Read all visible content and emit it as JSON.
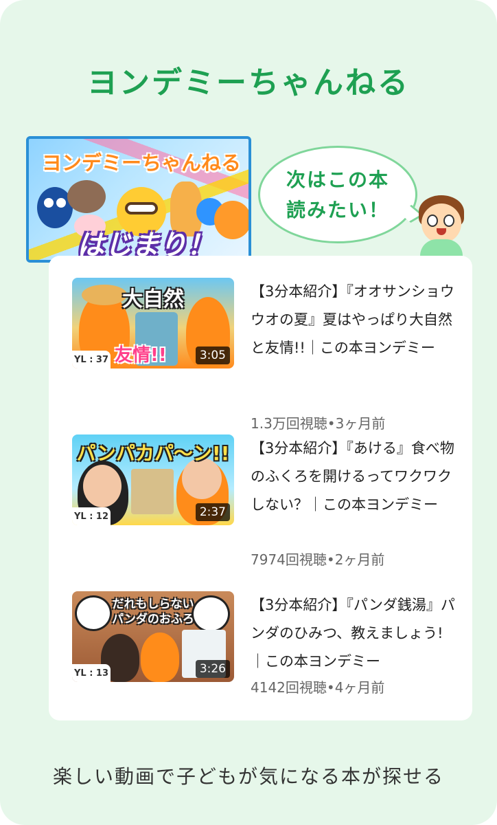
{
  "page": {
    "title": "ヨンデミーちゃんねる",
    "footer_text": "楽しい動画で子どもが気になる本が探せる"
  },
  "banner": {
    "title": "ヨンデミーちゃんねる",
    "subtitle": "はじまり！"
  },
  "bubble": {
    "line1": "次はこの本",
    "line2": "読みたい！"
  },
  "videos": [
    {
      "thumb_title": "大自然",
      "thumb_sub": "友情!!",
      "yl": "YL : 37",
      "duration": "3:05",
      "title": "【3分本紹介】『オオサンショウウオの夏』夏はやっぱり大自然と友情!!｜この本ヨンデミー",
      "meta": "1.3万回視聴•3ヶ月前"
    },
    {
      "thumb_title": "パンパカパ〜ン!!",
      "thumb_sub": "",
      "yl": "YL : 12",
      "duration": "2:37",
      "title": "【3分本紹介】『あける』食べ物のふくろを開けるってワクワクしない？｜この本ヨンデミー",
      "meta": "7974回視聴•2ヶ月前"
    },
    {
      "thumb_title": "だれもしらないパンダのおふろ",
      "thumb_sub": "",
      "yl": "YL : 13",
      "duration": "3:26",
      "title": "【3分本紹介】『パンダ銭湯』パンダのひみつ、教えましょう!｜この本ヨンデミー",
      "meta": "4142回視聴•4ヶ月前"
    }
  ],
  "colors": {
    "background": "#e6f7ea",
    "accent_green": "#1ea052",
    "bubble_border": "#7fd69a",
    "card": "#ffffff"
  }
}
